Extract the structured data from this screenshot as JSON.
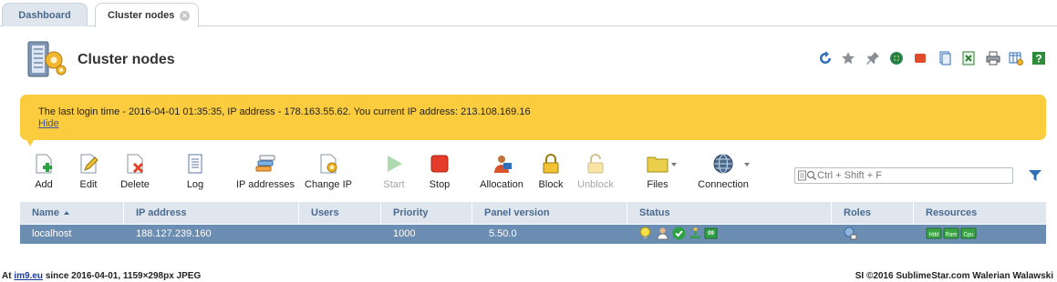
{
  "tabs": [
    {
      "label": "Dashboard",
      "active": false
    },
    {
      "label": "Cluster nodes",
      "active": true
    }
  ],
  "page": {
    "title": "Cluster nodes",
    "header_icons": [
      "refresh-icon",
      "star-icon",
      "pin-icon",
      "globe-icon",
      "stop-record-icon",
      "copy-icon",
      "excel-icon",
      "print-icon",
      "table-settings-icon",
      "help-icon"
    ]
  },
  "notice": {
    "text": "The last login time - 2016-04-01 01:35:35, IP address - 178.163.55.62. You current IP address: 213.108.169.16",
    "hide_label": "Hide",
    "color": "#fbcc3e"
  },
  "toolbar": {
    "add": "Add",
    "edit": "Edit",
    "delete": "Delete",
    "log": "Log",
    "ip_addresses": "IP addresses",
    "change_ip": "Change IP",
    "start": "Start",
    "stop": "Stop",
    "allocation": "Allocation",
    "block": "Block",
    "unblock": "Unblock",
    "files": "Files",
    "connection": "Connection"
  },
  "search": {
    "placeholder": "Ctrl + Shift + F"
  },
  "table": {
    "columns": [
      "Name",
      "IP address",
      "Users",
      "Priority",
      "Panel version",
      "Status",
      "Roles",
      "Resources"
    ],
    "sorted_column": "Name",
    "sort_direction": "ascending",
    "rows": [
      {
        "name": "localhost",
        "ip_address": "188.127.239.160",
        "users": "",
        "priority": "1000",
        "panel_version": "5.50.0",
        "status_icons": [
          "bulb-icon",
          "user-icon",
          "check-icon",
          "network-icon",
          "version-icon"
        ],
        "role_icons": [
          "node-role-icon"
        ],
        "resource_icons": [
          "hdd-icon",
          "ram-icon",
          "cpu-icon"
        ],
        "selected": true
      }
    ]
  },
  "footer": {
    "left_prefix": "At",
    "left_link": "im9.eu",
    "left_suffix": "since 2016-04-01, 1159×298px JPEG",
    "right": "SI ©2016 SublimeStar.com Walerian Walawski"
  },
  "colors": {
    "accent": "#4a6a8f",
    "selected_row": "#6b8db1",
    "header_bg": "#dfe6ee",
    "notice": "#fbcc3e"
  }
}
